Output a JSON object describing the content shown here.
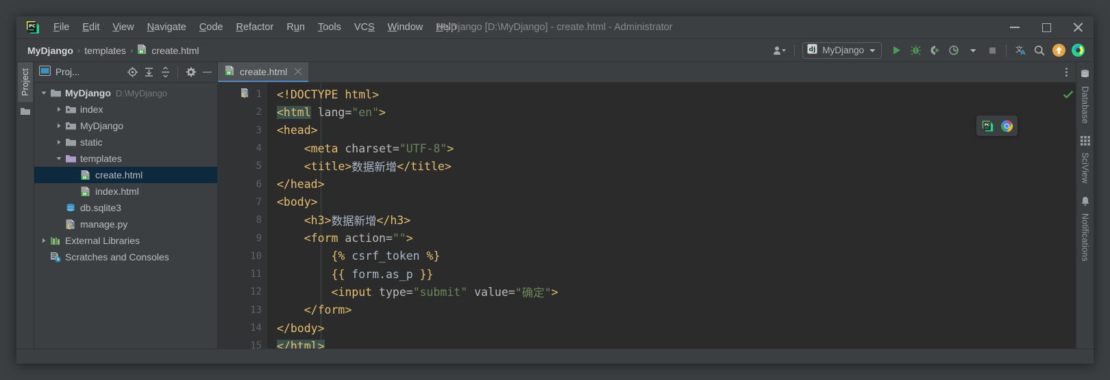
{
  "window": {
    "title": "MyDjango [D:\\MyDjango] - create.html - Administrator",
    "logo_icon": "pycharm-logo-icon",
    "minimize_icon": "minimize-icon",
    "maximize_icon": "maximize-icon",
    "close_icon": "close-icon"
  },
  "menu": {
    "items": [
      {
        "label": "File",
        "mnemonic": "F"
      },
      {
        "label": "Edit",
        "mnemonic": "E"
      },
      {
        "label": "View",
        "mnemonic": "V"
      },
      {
        "label": "Navigate",
        "mnemonic": "N"
      },
      {
        "label": "Code",
        "mnemonic": "C"
      },
      {
        "label": "Refactor",
        "mnemonic": "R"
      },
      {
        "label": "Run",
        "mnemonic": "u"
      },
      {
        "label": "Tools",
        "mnemonic": "T"
      },
      {
        "label": "VCS",
        "mnemonic": "S"
      },
      {
        "label": "Window",
        "mnemonic": "W"
      },
      {
        "label": "Help",
        "mnemonic": "H"
      }
    ]
  },
  "breadcrumb": {
    "items": [
      {
        "label": "MyDjango",
        "icon": ""
      },
      {
        "label": "templates",
        "icon": ""
      },
      {
        "label": "create.html",
        "icon": "html-file-icon"
      }
    ],
    "separator": "›"
  },
  "toolbar": {
    "user_icon": "user-account-icon",
    "run_config": {
      "label": "MyDjango",
      "icon": "django-icon",
      "chevron": "chevron-down-icon"
    },
    "buttons": [
      {
        "name": "run-button",
        "icon": "play-icon",
        "title": "Run"
      },
      {
        "name": "debug-button",
        "icon": "bug-icon",
        "title": "Debug"
      },
      {
        "name": "coverage-button",
        "icon": "coverage-icon",
        "title": "Run with Coverage"
      },
      {
        "name": "profile-button",
        "icon": "profile-icon",
        "title": "Profile"
      },
      {
        "name": "stop-button",
        "icon": "stop-icon",
        "title": "Stop"
      },
      {
        "name": "translate-button",
        "icon": "translate-icon",
        "title": "Translate"
      },
      {
        "name": "search-button",
        "icon": "search-icon",
        "title": "Search Everywhere"
      },
      {
        "name": "update-button",
        "icon": "update-arrow-icon",
        "title": "Update"
      },
      {
        "name": "ide-button",
        "icon": "pycharm-round-icon",
        "title": "IDE"
      }
    ]
  },
  "left_rail": {
    "tab_label": "Project",
    "folder_icon": "folder-icon"
  },
  "project_panel": {
    "title": "Proj...",
    "window_icon": "project-window-icon",
    "actions": [
      {
        "name": "locate-button",
        "icon": "crosshair-icon"
      },
      {
        "name": "expand-button",
        "icon": "expand-all-icon"
      },
      {
        "name": "collapse-button",
        "icon": "collapse-all-icon"
      },
      {
        "name": "settings-button",
        "icon": "gear-icon"
      },
      {
        "name": "hide-button",
        "icon": "minimize-icon"
      }
    ],
    "tree": [
      {
        "label": "MyDjango",
        "sub": "D:\\MyDjango",
        "indent": 0,
        "arrow": "down",
        "icon": "folder-icon",
        "bold": true,
        "selected": false
      },
      {
        "label": "index",
        "sub": "",
        "indent": 1,
        "arrow": "right",
        "icon": "module-folder-icon",
        "bold": false,
        "selected": false
      },
      {
        "label": "MyDjango",
        "sub": "",
        "indent": 1,
        "arrow": "right",
        "icon": "module-folder-icon",
        "bold": false,
        "selected": false
      },
      {
        "label": "static",
        "sub": "",
        "indent": 1,
        "arrow": "right",
        "icon": "folder-icon",
        "bold": false,
        "selected": false
      },
      {
        "label": "templates",
        "sub": "",
        "indent": 1,
        "arrow": "down",
        "icon": "templates-folder-icon",
        "bold": false,
        "selected": false
      },
      {
        "label": "create.html",
        "sub": "",
        "indent": 2,
        "arrow": "none",
        "icon": "html-file-icon",
        "bold": false,
        "selected": true
      },
      {
        "label": "index.html",
        "sub": "",
        "indent": 2,
        "arrow": "none",
        "icon": "html-file-icon",
        "bold": false,
        "selected": false
      },
      {
        "label": "db.sqlite3",
        "sub": "",
        "indent": 1,
        "arrow": "none",
        "icon": "database-file-icon",
        "bold": false,
        "selected": false
      },
      {
        "label": "manage.py",
        "sub": "",
        "indent": 1,
        "arrow": "none",
        "icon": "python-file-icon",
        "bold": false,
        "selected": false
      },
      {
        "label": "External Libraries",
        "sub": "",
        "indent": 0,
        "arrow": "right",
        "icon": "libraries-icon",
        "bold": false,
        "selected": false
      },
      {
        "label": "Scratches and Consoles",
        "sub": "",
        "indent": 0,
        "arrow": "none",
        "icon": "scratches-icon",
        "bold": false,
        "selected": false
      }
    ]
  },
  "editor": {
    "tab": {
      "label": "create.html",
      "icon": "html-file-icon",
      "close_icon": "close-icon"
    },
    "more_icon": "more-options-icon",
    "inspection_icon": "inspection-ok-icon",
    "preview_popup": [
      {
        "name": "preview-pycharm-button",
        "icon": "pycharm-logo-icon"
      },
      {
        "name": "preview-chrome-button",
        "icon": "chrome-icon"
      }
    ],
    "run_marker_icon": "python-run-icon",
    "lines": [
      {
        "n": 1,
        "fold": "none",
        "tokens": [
          {
            "t": "tag",
            "s": "<!DOCTYPE html>"
          }
        ]
      },
      {
        "n": 2,
        "fold": "open",
        "tokens": [
          {
            "t": "tag hl",
            "s": "<html"
          },
          {
            "t": "attr",
            "s": " lang="
          },
          {
            "t": "val",
            "s": "\"en\""
          },
          {
            "t": "tag",
            "s": ">"
          }
        ]
      },
      {
        "n": 3,
        "fold": "open",
        "tokens": [
          {
            "t": "tag",
            "s": "<head>"
          }
        ]
      },
      {
        "n": 4,
        "fold": "none",
        "tokens": [
          {
            "t": "tag",
            "s": "    <meta"
          },
          {
            "t": "attr",
            "s": " charset="
          },
          {
            "t": "val",
            "s": "\"UTF-8\""
          },
          {
            "t": "tag",
            "s": ">"
          }
        ]
      },
      {
        "n": 5,
        "fold": "none",
        "tokens": [
          {
            "t": "tag",
            "s": "    <title>"
          },
          {
            "t": "txt",
            "s": "数据新增"
          },
          {
            "t": "tag",
            "s": "</title>"
          }
        ]
      },
      {
        "n": 6,
        "fold": "close",
        "tokens": [
          {
            "t": "tag",
            "s": "</head>"
          }
        ]
      },
      {
        "n": 7,
        "fold": "open",
        "tokens": [
          {
            "t": "tag",
            "s": "<body>"
          }
        ]
      },
      {
        "n": 8,
        "fold": "none",
        "tokens": [
          {
            "t": "tag",
            "s": "    <h3>"
          },
          {
            "t": "txt",
            "s": "数据新增"
          },
          {
            "t": "tag",
            "s": "</h3>"
          }
        ]
      },
      {
        "n": 9,
        "fold": "open",
        "tokens": [
          {
            "t": "tag",
            "s": "    <form"
          },
          {
            "t": "attr",
            "s": " action="
          },
          {
            "t": "val",
            "s": "\"\""
          },
          {
            "t": "tag",
            "s": ">"
          }
        ]
      },
      {
        "n": 10,
        "fold": "none",
        "tokens": [
          {
            "t": "dj",
            "s": "        {% "
          },
          {
            "t": "djx",
            "s": "csrf_token"
          },
          {
            "t": "dj",
            "s": " %}"
          }
        ]
      },
      {
        "n": 11,
        "fold": "none",
        "tokens": [
          {
            "t": "dj",
            "s": "        {{ "
          },
          {
            "t": "djx",
            "s": "form.as_p"
          },
          {
            "t": "dj",
            "s": " }}"
          }
        ]
      },
      {
        "n": 12,
        "fold": "none",
        "tokens": [
          {
            "t": "tag",
            "s": "        <input"
          },
          {
            "t": "attr",
            "s": " type="
          },
          {
            "t": "val",
            "s": "\"submit\""
          },
          {
            "t": "attr",
            "s": " value="
          },
          {
            "t": "val",
            "s": "\"确定\""
          },
          {
            "t": "tag",
            "s": ">"
          }
        ]
      },
      {
        "n": 13,
        "fold": "close",
        "tokens": [
          {
            "t": "tag",
            "s": "    </form>"
          }
        ]
      },
      {
        "n": 14,
        "fold": "close",
        "tokens": [
          {
            "t": "tag",
            "s": "</body>"
          }
        ]
      },
      {
        "n": 15,
        "fold": "close",
        "tokens": [
          {
            "t": "tag hl",
            "s": "</html>"
          }
        ]
      }
    ]
  },
  "right_rail": {
    "tabs": [
      {
        "label": "Database",
        "icon": "database-icon"
      },
      {
        "label": "SciView",
        "icon": "sciview-grid-icon"
      },
      {
        "label": "Notifications",
        "icon": "bell-icon"
      }
    ]
  },
  "colors": {
    "panel_bg": "#3c3f41",
    "editor_bg": "#2b2b2b",
    "gutter_bg": "#313335",
    "selection": "#0d293e",
    "accent": "#4a88c7",
    "tag": "#e8bf6a",
    "value": "#6a8759",
    "text": "#a9b7c6",
    "run_green": "#499c54",
    "update_orange": "#e8a33d"
  }
}
